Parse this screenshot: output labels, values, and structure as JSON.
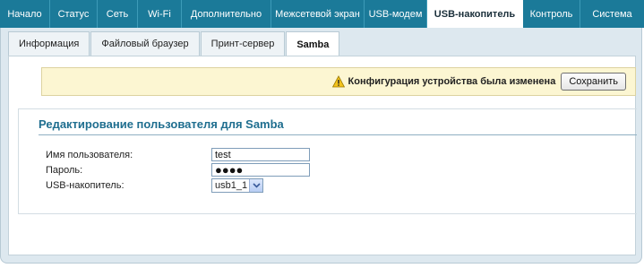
{
  "nav": {
    "items": [
      {
        "label": "Начало"
      },
      {
        "label": "Статус"
      },
      {
        "label": "Сеть"
      },
      {
        "label": "Wi-Fi"
      },
      {
        "label": "Дополнительно"
      },
      {
        "label": "Межсетевой экран"
      },
      {
        "label": "USB-модем"
      },
      {
        "label": "USB-накопитель"
      },
      {
        "label": "Контроль"
      },
      {
        "label": "Система"
      }
    ],
    "active": "USB-накопитель"
  },
  "subtabs": [
    {
      "label": "Информация"
    },
    {
      "label": "Файловый браузер"
    },
    {
      "label": "Принт-сервер"
    },
    {
      "label": "Samba"
    }
  ],
  "notice": {
    "message": "Конфигурация устройства была изменена",
    "save_label": "Сохранить",
    "icon": "warning-icon"
  },
  "form": {
    "title": "Редактирование пользователя для Samba",
    "username_label": "Имя пользователя:",
    "username_value": "test",
    "password_label": "Пароль:",
    "password_value": "●●●●",
    "usb_label": "USB-накопитель:",
    "usb_value": "usb1_1"
  },
  "colors": {
    "nav_bg": "#1b7a99",
    "title": "#1f6e8f",
    "notice_bg": "#fcf6d2"
  }
}
